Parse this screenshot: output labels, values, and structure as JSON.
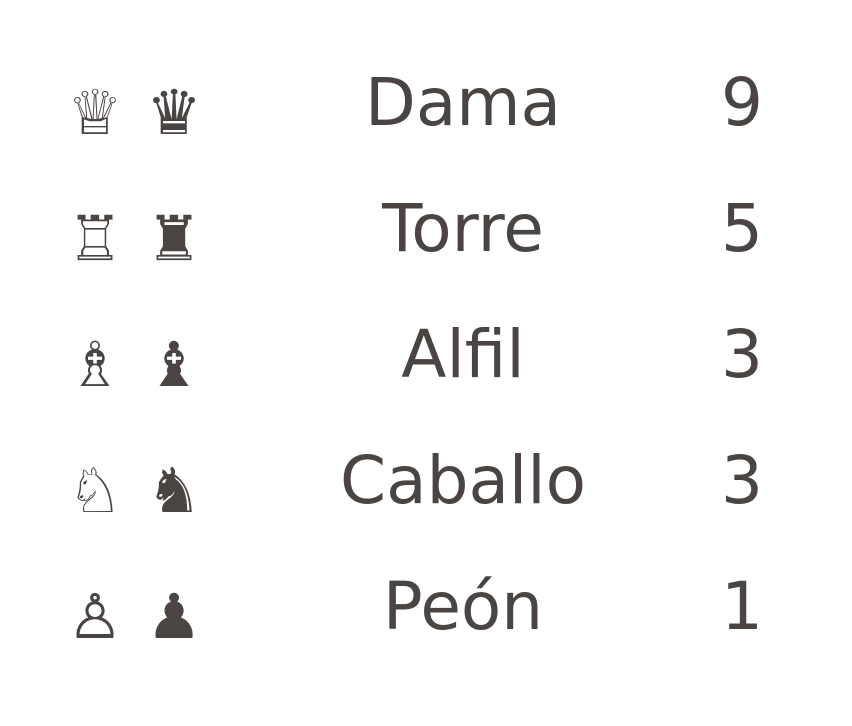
{
  "pieces": [
    {
      "white_glyph": "♕",
      "black_glyph": "♛",
      "white_icon": "white-queen",
      "black_icon": "black-queen",
      "name": "Dama",
      "value": "9"
    },
    {
      "white_glyph": "♖",
      "black_glyph": "♜",
      "white_icon": "white-rook",
      "black_icon": "black-rook",
      "name": "Torre",
      "value": "5"
    },
    {
      "white_glyph": "♗",
      "black_glyph": "♝",
      "white_icon": "white-bishop",
      "black_icon": "black-bishop",
      "name": "Alfil",
      "value": "3"
    },
    {
      "white_glyph": "♘",
      "black_glyph": "♞",
      "white_icon": "white-knight",
      "black_icon": "black-knight",
      "name": "Caballo",
      "value": "3"
    },
    {
      "white_glyph": "♙",
      "black_glyph": "♟",
      "white_icon": "white-pawn",
      "black_icon": "black-pawn",
      "name": "Peón",
      "value": "1"
    }
  ],
  "colors": {
    "text": "#4a4543",
    "background": "#ffffff"
  }
}
